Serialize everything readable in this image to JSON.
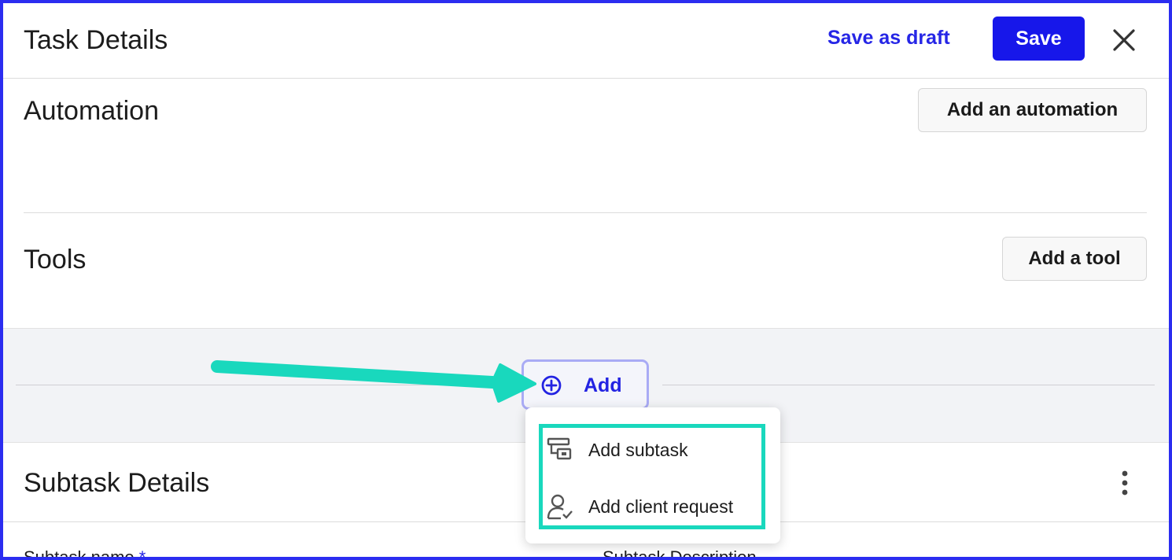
{
  "header": {
    "title": "Task Details",
    "save_draft_label": "Save as draft",
    "save_label": "Save",
    "close_icon": "close-icon"
  },
  "automation": {
    "title": "Automation",
    "button_label": "Add an automation"
  },
  "tools": {
    "title": "Tools",
    "button_label": "Add a tool"
  },
  "add_control": {
    "label": "Add",
    "icon": "plus-circle-icon"
  },
  "dropdown": {
    "items": [
      {
        "label": "Add subtask",
        "icon": "subtask-icon"
      },
      {
        "label": "Add client request",
        "icon": "client-request-icon"
      }
    ]
  },
  "subtask": {
    "title": "Subtask Details",
    "name_label": "Subtask name",
    "required_mark": "*",
    "description_label": "Subtask Description",
    "menu_icon": "kebab-menu-icon"
  },
  "colors": {
    "accent": "#1717ea",
    "frame_border": "#2b2df0",
    "annotation": "#19d8bd",
    "band": "#f2f3f6"
  }
}
